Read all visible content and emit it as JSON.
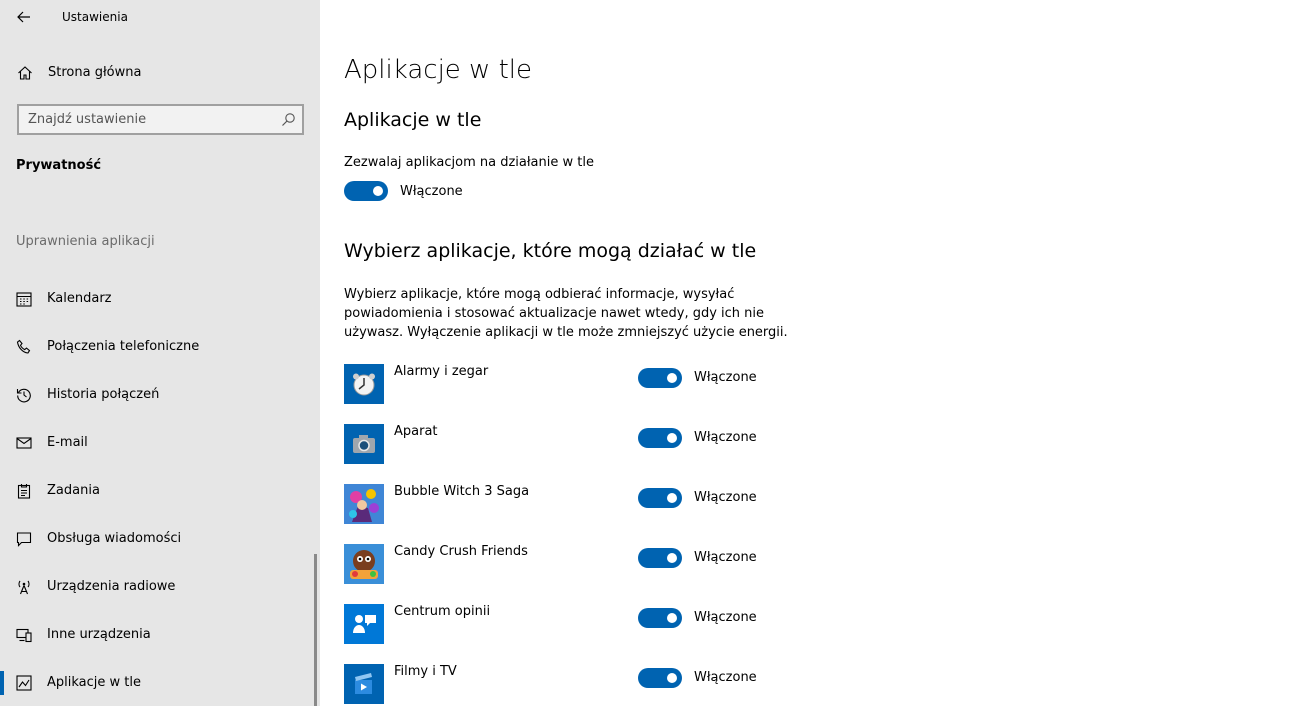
{
  "app": {
    "title": "Ustawienia"
  },
  "sidebar": {
    "home_label": "Strona główna",
    "search_placeholder": "Znajdź ustawienie",
    "section_title": "Prywatność",
    "group_header": "Uprawnienia aplikacji",
    "items": [
      {
        "label": "Kalendarz",
        "icon": "calendar-icon"
      },
      {
        "label": "Połączenia telefoniczne",
        "icon": "phone-icon"
      },
      {
        "label": "Historia połączeń",
        "icon": "history-icon"
      },
      {
        "label": "E-mail",
        "icon": "mail-icon"
      },
      {
        "label": "Zadania",
        "icon": "tasks-icon"
      },
      {
        "label": "Obsługa wiadomości",
        "icon": "message-icon"
      },
      {
        "label": "Urządzenia radiowe",
        "icon": "radio-icon"
      },
      {
        "label": "Inne urządzenia",
        "icon": "devices-icon"
      },
      {
        "label": "Aplikacje w tle",
        "icon": "background-apps-icon",
        "active": true
      }
    ]
  },
  "main": {
    "page_title": "Aplikacje w tle",
    "section1_title": "Aplikacje w tle",
    "allow_label": "Zezwalaj aplikacjom na działanie w tle",
    "allow_toggle": {
      "state": "on",
      "label": "Włączone"
    },
    "section2_title": "Wybierz aplikacje, które mogą działać w tle",
    "description_lines": [
      "Wybierz aplikacje, które mogą odbierać informacje, wysyłać",
      "powiadomienia i stosować aktualizacje nawet wtedy, gdy ich nie",
      "używasz. Wyłączenie aplikacji w tle może zmniejszyć użycie energii."
    ],
    "apps": [
      {
        "name": "Alarmy i zegar",
        "toggle": "Włączone",
        "icon": "alarm-clock-icon",
        "color": "#0063b1"
      },
      {
        "name": "Aparat",
        "toggle": "Włączone",
        "icon": "camera-icon",
        "color": "#0063b1"
      },
      {
        "name": "Bubble Witch 3 Saga",
        "toggle": "Włączone",
        "icon": "bubble-witch-icon",
        "color": "#1e73c8"
      },
      {
        "name": "Candy Crush Friends",
        "toggle": "Włączone",
        "icon": "candy-crush-icon",
        "color": "#1e73c8"
      },
      {
        "name": "Centrum opinii",
        "toggle": "Włączone",
        "icon": "feedback-hub-icon",
        "color": "#0078d7"
      },
      {
        "name": "Filmy i TV",
        "toggle": "Włączone",
        "icon": "movies-tv-icon",
        "color": "#0063b1"
      }
    ]
  },
  "colors": {
    "accent": "#0063b1",
    "sidebar_bg": "#e6e6e6"
  }
}
